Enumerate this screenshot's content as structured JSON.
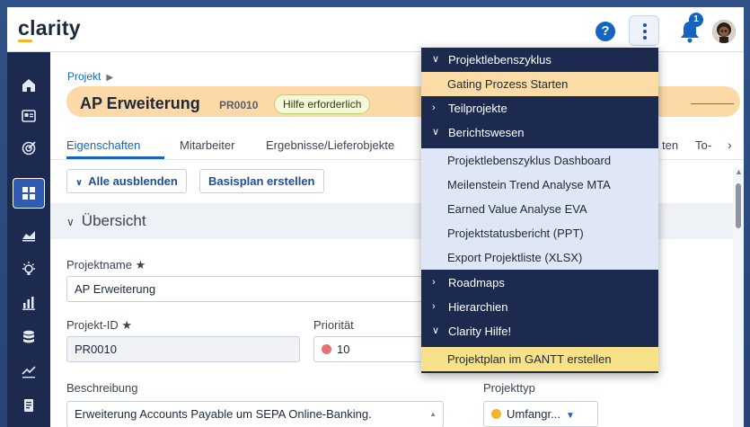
{
  "app": {
    "logo": "clarity"
  },
  "topbar": {
    "help_glyph": "?",
    "notification_count": "1"
  },
  "breadcrumb": {
    "label": "Projekt"
  },
  "project": {
    "name": "AP Erweiterung",
    "code": "PR0010",
    "status": "Hilfe erforderlich"
  },
  "tabs": [
    {
      "label": "Eigenschaften"
    },
    {
      "label": "Mitarbeiter"
    },
    {
      "label": "Ergebnisse/Lieferobjekte"
    },
    {
      "label": "ten"
    },
    {
      "label": "To-"
    }
  ],
  "toolbar": {
    "collapse_label": "Alle ausblenden",
    "baseline_label": "Basisplan erstellen"
  },
  "section": {
    "title": "Übersicht"
  },
  "fields": {
    "name_label": "Projektname",
    "name_value": "AP Erweiterung",
    "id_label": "Projekt-ID",
    "id_value": "PR0010",
    "priority_label": "Priorität",
    "priority_value": "10",
    "description_label": "Beschreibung",
    "description_value": "Erweiterung Accounts Payable um SEPA Online-Banking.",
    "type_label": "Projekttyp",
    "type_value": "Umfangr...",
    "required_mark": "★"
  },
  "menu": {
    "items": [
      {
        "label": "Projektlebenszyklus"
      },
      {
        "label": "Gating Prozess Starten"
      },
      {
        "label": "Teilprojekte"
      },
      {
        "label": "Berichtswesen"
      },
      {
        "label": "Projektlebenszyklus Dashboard"
      },
      {
        "label": "Meilenstein Trend Analyse MTA"
      },
      {
        "label": "Earned Value Analyse EVA"
      },
      {
        "label": "Projektstatusbericht (PPT)"
      },
      {
        "label": "Export Projektliste (XLSX)"
      },
      {
        "label": "Roadmaps"
      },
      {
        "label": "Hierarchien"
      },
      {
        "label": "Clarity Hilfe!"
      },
      {
        "label": "Projektplan im GANTT erstellen"
      }
    ]
  },
  "colors": {
    "accent": "#1565c0",
    "nav_bg": "#1b2a4e",
    "status_pill_border": "#b5d46c",
    "header_band": "#fdd9a8",
    "priority_dot": "#e57373",
    "type_dot": "#f6b324"
  },
  "icons": [
    "home-icon",
    "contacts-icon",
    "target-icon",
    "grid-icon",
    "area-chart-icon",
    "lightbulb-icon",
    "bar-chart-icon",
    "database-icon",
    "line-chart-icon",
    "document-icon",
    "help-icon",
    "kebab-icon",
    "bell-icon",
    "avatar"
  ]
}
